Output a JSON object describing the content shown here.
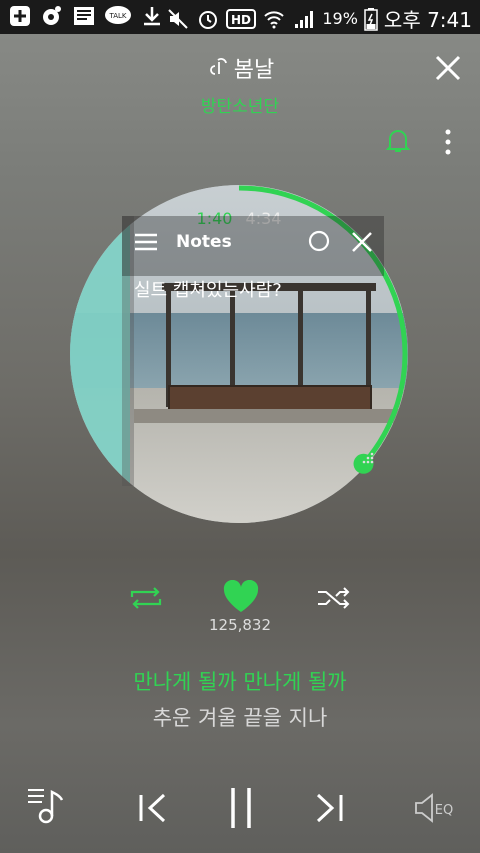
{
  "status_bar": {
    "battery_percent": "19%",
    "time": "오후 7:41",
    "icons": [
      "add-icon",
      "music-app-icon",
      "news-icon",
      "talk-icon",
      "download-icon",
      "mute-icon",
      "alarm-icon",
      "hd-icon",
      "wifi-icon",
      "signal-icon",
      "battery-charging-icon"
    ],
    "talk_label": "TALK",
    "hd_label": "HD"
  },
  "header": {
    "song_title": "봄날",
    "artist": "방탄소년단"
  },
  "player": {
    "current_time": "1:40",
    "total_time": "4:34",
    "progress": 0.365,
    "accent_color": "#31d353"
  },
  "notes_overlay": {
    "title": "Notes",
    "text": "실트 캡쳐있는사람?"
  },
  "actions": {
    "like_count": "125,832"
  },
  "lyrics": {
    "current_line": "만나게 될까 만나게 될까",
    "next_line": "추운 겨울 끝을 지나"
  },
  "bottom_controls": {
    "eq_label": "EQ"
  }
}
